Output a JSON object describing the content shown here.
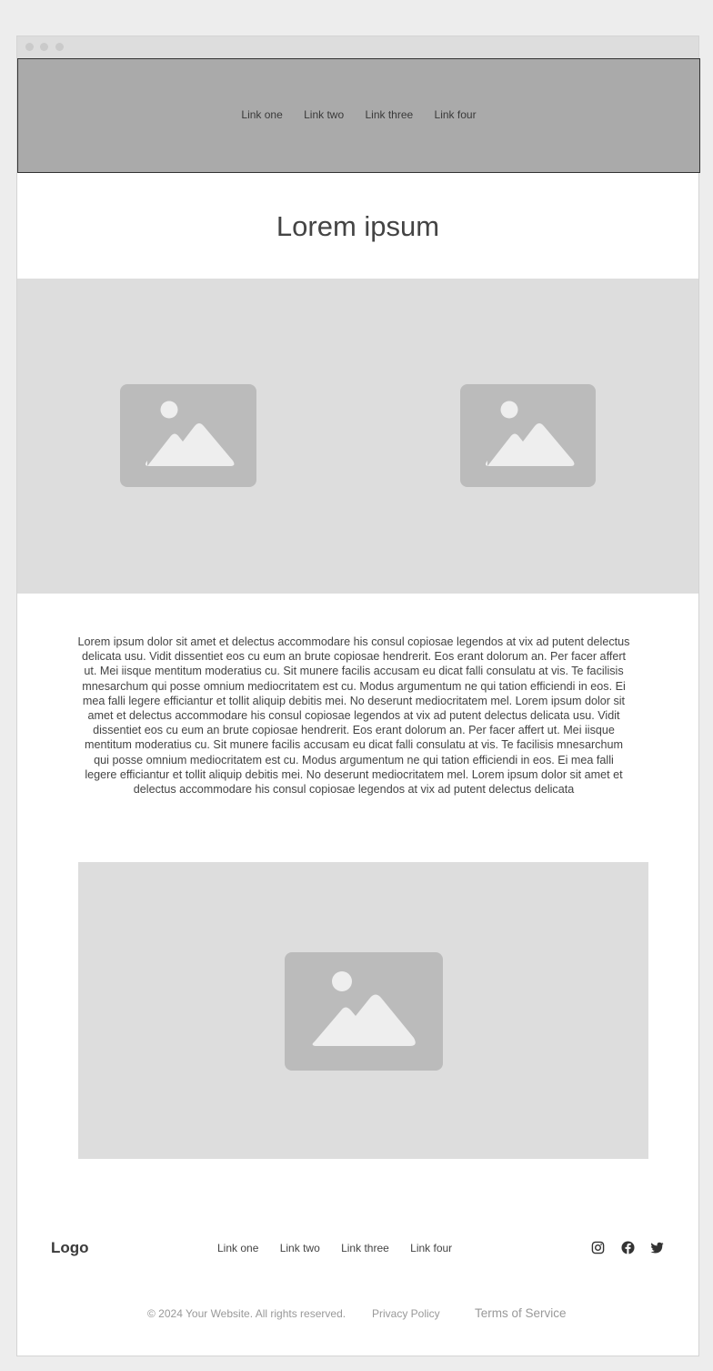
{
  "header": {
    "nav": [
      "Link one",
      "Link two",
      "Link three",
      "Link four"
    ]
  },
  "hero": {
    "title": "Lorem ipsum"
  },
  "content": {
    "paragraph": "Lorem ipsum dolor sit amet et delectus accommodare his consul copiosae legendos at vix ad putent delectus delicata usu. Vidit dissentiet eos cu eum an brute copiosae hendrerit. Eos erant dolorum an. Per facer affert ut. Mei iisque mentitum moderatius cu. Sit munere facilis accusam eu dicat falli consulatu at vis. Te facilisis mnesarchum qui posse omnium mediocritatem est cu. Modus argumentum ne qui tation efficiendi in eos. Ei mea falli legere efficiantur et tollit aliquip debitis mei. No deserunt mediocritatem mel. Lorem ipsum dolor sit amet et delectus accommodare his consul copiosae legendos at vix ad putent delectus delicata usu. Vidit dissentiet eos cu eum an brute copiosae hendrerit. Eos erant dolorum an. Per facer affert ut. Mei iisque mentitum moderatius cu. Sit munere facilis accusam eu dicat falli consulatu at vis. Te facilisis mnesarchum qui posse omnium mediocritatem est cu. Modus argumentum ne qui tation efficiendi in eos. Ei mea falli legere efficiantur et tollit aliquip debitis mei. No deserunt mediocritatem mel. Lorem ipsum dolor sit amet et delectus accommodare his consul copiosae legendos at vix ad putent delectus delicata"
  },
  "footer": {
    "logo": "Logo",
    "nav": [
      "Link one",
      "Link two",
      "Link three",
      "Link four"
    ],
    "social_icons": [
      "instagram-icon",
      "facebook-icon",
      "twitter-icon"
    ],
    "copyright": "© 2024 Your Website. All rights reserved.",
    "privacy": "Privacy Policy",
    "terms": "Terms of Service"
  },
  "colors": {
    "page_background": "#ededed",
    "header_background": "#aaaaaa",
    "placeholder_background": "#dddddd",
    "placeholder_icon": "#bbbbbb",
    "text": "#444444",
    "muted_text": "#999999"
  }
}
